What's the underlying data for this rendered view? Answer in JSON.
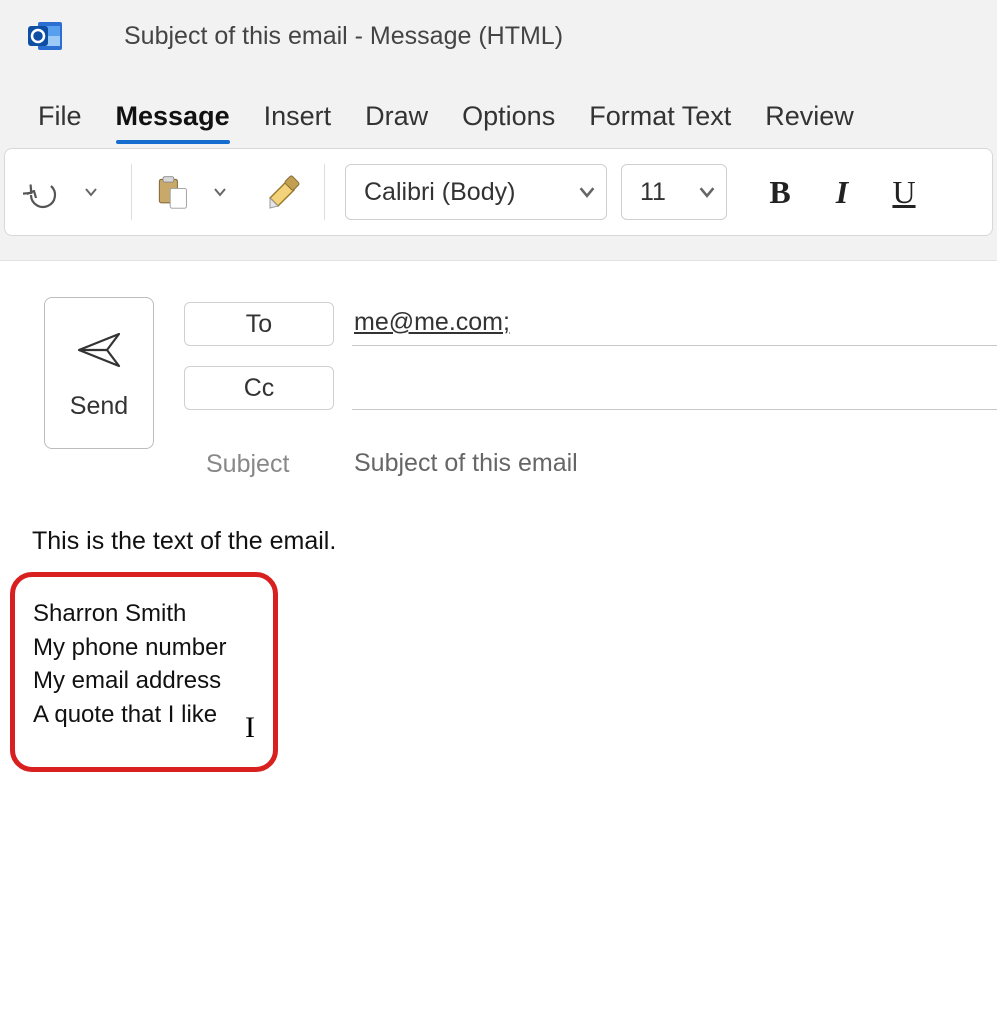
{
  "window": {
    "title": "Subject of this email  -  Message (HTML)"
  },
  "tabs": {
    "file": "File",
    "message": "Message",
    "insert": "Insert",
    "draw": "Draw",
    "options": "Options",
    "format_text": "Format Text",
    "review": "Review",
    "active": "message"
  },
  "toolbar": {
    "font_name": "Calibri (Body)",
    "font_size": "11",
    "bold_label": "B",
    "italic_label": "I",
    "underline_label": "U"
  },
  "compose": {
    "send_label": "Send",
    "to_label": "To",
    "cc_label": "Cc",
    "subject_label": "Subject",
    "to_value": "me@me.com;",
    "cc_value": "",
    "subject_value": "Subject of this email"
  },
  "body": {
    "text": "This is the text of the email.",
    "signature_lines": {
      "l1": "Sharron Smith",
      "l2": "My phone number",
      "l3": "My email address",
      "l4": "A quote that I like"
    }
  }
}
